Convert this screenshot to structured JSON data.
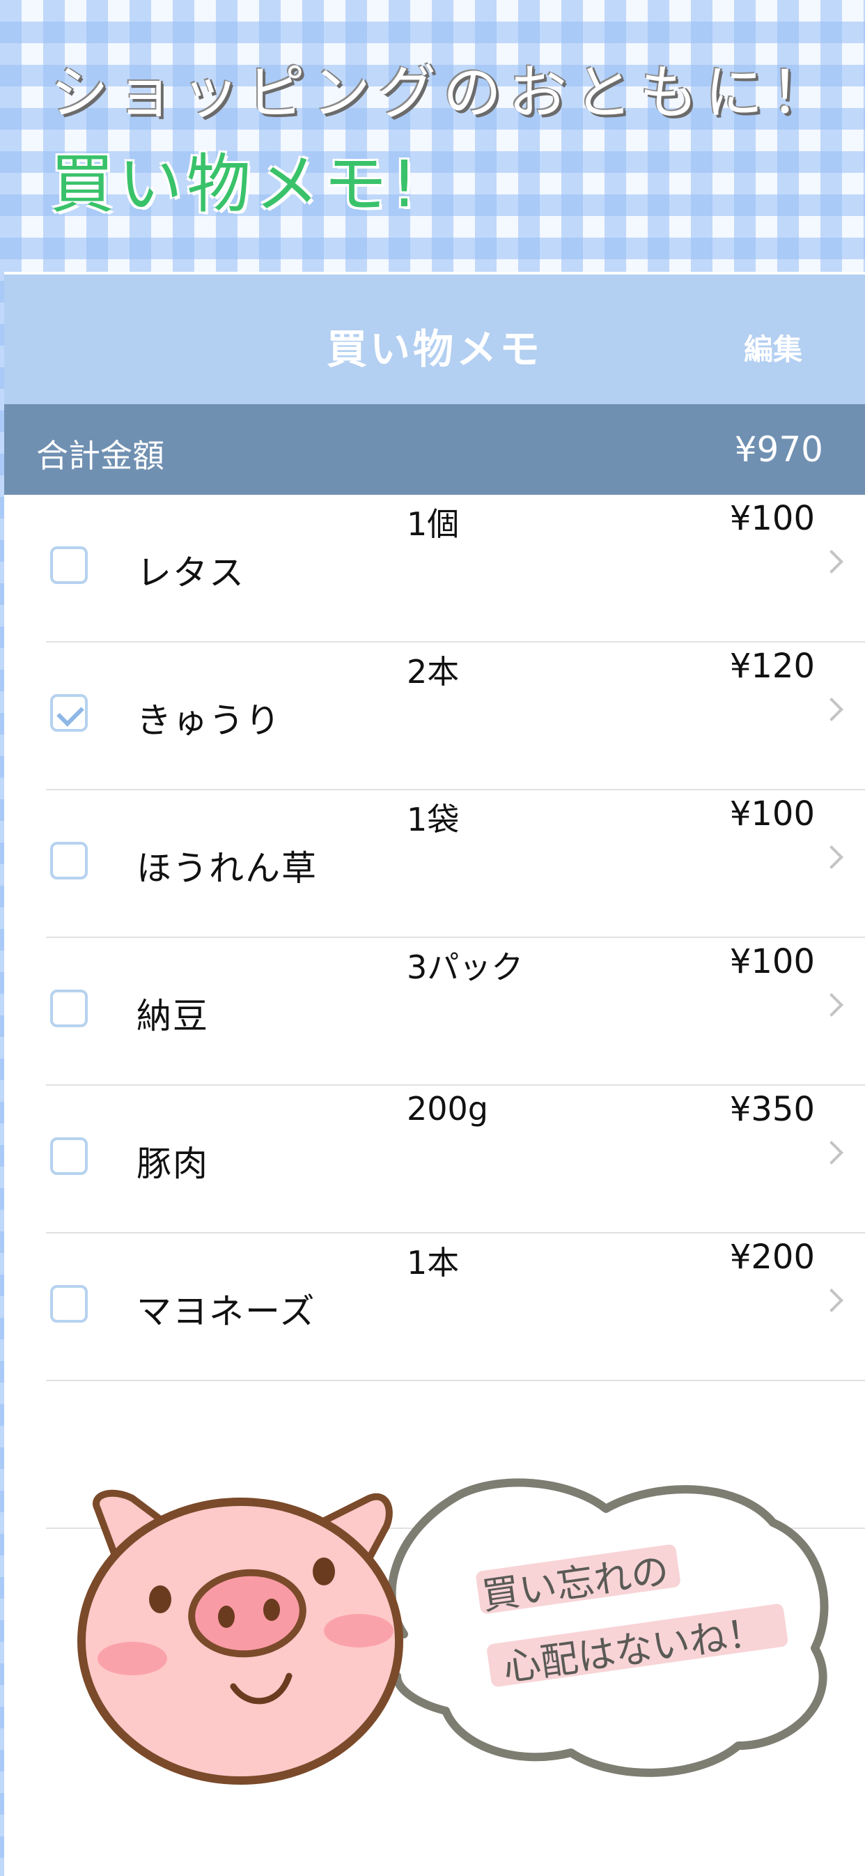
{
  "promo": {
    "line1": "ショッピングのおともに！",
    "line2": "買い物メモ!"
  },
  "navbar": {
    "title": "買い物メモ",
    "edit_label": "編集"
  },
  "total": {
    "label": "合計金額",
    "value": "¥970"
  },
  "items": [
    {
      "name": "レタス",
      "qty": "1個",
      "price": "¥100",
      "checked": false
    },
    {
      "name": "きゅうり",
      "qty": "2本",
      "price": "¥120",
      "checked": true
    },
    {
      "name": "ほうれん草",
      "qty": "1袋",
      "price": "¥100",
      "checked": false
    },
    {
      "name": "納豆",
      "qty": "3パック",
      "price": "¥100",
      "checked": false
    },
    {
      "name": "豚肉",
      "qty": "200g",
      "price": "¥350",
      "checked": false
    },
    {
      "name": "マヨネーズ",
      "qty": "1本",
      "price": "¥200",
      "checked": false
    }
  ],
  "bubble": {
    "line1": "買い忘れの",
    "line2": "心配はないね！"
  },
  "colors": {
    "navbar": "#b3cff1",
    "totalbar": "#7090b2",
    "accent_green": "#39c26a",
    "checkbox": "#b6d2ef"
  }
}
